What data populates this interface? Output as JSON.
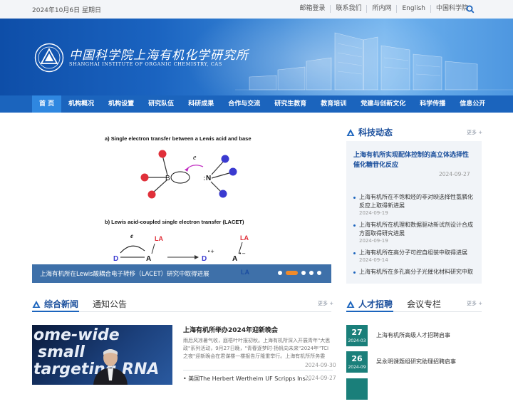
{
  "topbar": {
    "date": "2024年10月6日 星期日",
    "links": [
      "邮箱登录",
      "联系我们",
      "所内网",
      "English",
      "中国科学院"
    ],
    "search_icon": "search-icon"
  },
  "banner": {
    "title_cn": "中国科学院上海有机化学研究所",
    "title_en": "SHANGHAI INSTITUTE OF ORGANIC CHEMISTRY, CAS",
    "logo_icon": "institute-logo"
  },
  "nav": {
    "items": [
      "首 页",
      "机构概况",
      "机构设置",
      "研究队伍",
      "科研成果",
      "合作与交流",
      "研究生教育",
      "教育培训",
      "党建与创新文化",
      "科学传播",
      "信息公开"
    ],
    "active_index": 0
  },
  "slider": {
    "caption": "上海有机所在Lewis酸耦合电子转移（LACET）研究中取得进展",
    "diagram_title_a": "a) Single electron transfer between a Lewis acid and base",
    "diagram_title_b": "b) Lewis acid-coupled single electron transfer (LACET)",
    "label_B": "B",
    "label_N": "N",
    "label_e": "e",
    "label_D": "D",
    "label_A": "A",
    "label_LA": "LA",
    "dots": 5,
    "active_dot": 1
  },
  "science": {
    "title": "科技动态",
    "more": "更多 +",
    "feature_title": "上海有机所实现配体控制的高立体选择性催化糖苷化反应",
    "feature_date": "2024-09-27",
    "items": [
      {
        "title": "上海有机所在不饱和烃的非对映选择性氢膦化反应上取得新进展",
        "date": "2024-09-19"
      },
      {
        "title": "上海有机所在机理和数据驱动新试剂设计合成方面取得研究进展",
        "date": "2024-09-19"
      },
      {
        "title": "上海有机所在高分子可控自组装中取得进展",
        "date": "2024-09-14"
      },
      {
        "title": "上海有机所在多孔高分子光催化材料研究中取得进展",
        "date": "2024-09-13"
      }
    ]
  },
  "news": {
    "tab_active": "综合新闻",
    "tab_other": "通知公告",
    "more": "更多 +",
    "head_title": "上海有机所举办2024年迎新晚会",
    "head_desc": "雨后风凉暑气收，庭梧叶叶报初秋。上海有机所深入开展青年\"大思政\"系列活动，9月27日晚，\"青春逐梦时·扬帆向未来\"2024年\"TCI之夜\"迎新晚会在君谋楼一楼报告厅隆重举行。上海有机所所务委员...",
    "head_date": "2024-09-30",
    "image_text": [
      "ome-wide",
      "small",
      "targeting RNA"
    ],
    "sub_title": "美国The Herbert Wertheim UF Scripps Ins...",
    "sub_date": "2024-09-27"
  },
  "jobs": {
    "tab_active": "人才招聘",
    "tab_other": "会议专栏",
    "more": "更多 +",
    "items": [
      {
        "day": "27",
        "ym": "2024-03",
        "title": "上海有机所高级人才招聘启事"
      },
      {
        "day": "26",
        "ym": "2024-09",
        "title": "吴永明课题组研究助理招聘启事"
      },
      {
        "day": "",
        "ym": "",
        "title": ""
      }
    ]
  },
  "colors": {
    "primary": "#1b64bd",
    "dark_blue": "#1b4f9c",
    "accent_orange": "#f08a2a",
    "teal": "#1a7f7a",
    "red_atom": "#e0303a",
    "blue_atom": "#3a3ad0"
  }
}
